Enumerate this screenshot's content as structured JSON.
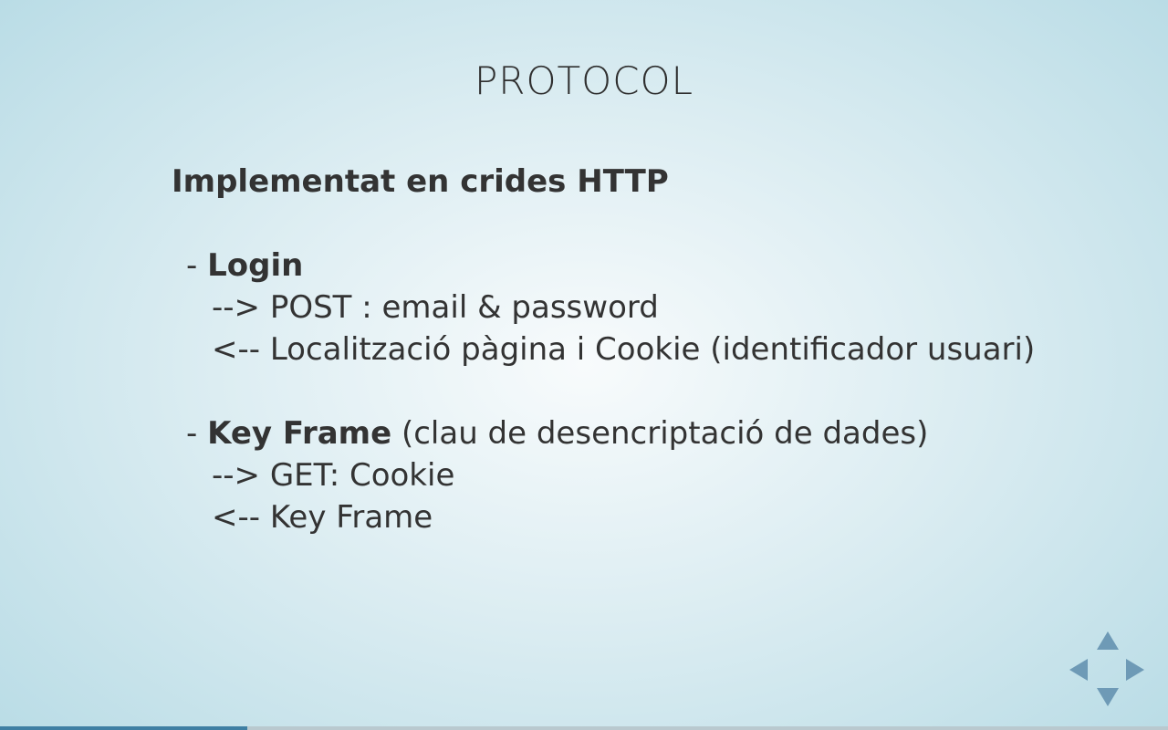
{
  "slide": {
    "title": "PROTOCOL",
    "heading": "Implementat en crides HTTP",
    "sections": [
      {
        "prefix": "- ",
        "label": "Login",
        "suffix": "",
        "lines": [
          "--> POST : email & password",
          "<-- Localització pàgina i Cookie (identificador usuari)"
        ]
      },
      {
        "prefix": "- ",
        "label": "Key Frame",
        "suffix": " (clau de desencriptació de dades)",
        "lines": [
          "--> GET: Cookie",
          "<-- Key Frame"
        ]
      }
    ]
  },
  "controls": {
    "icons": [
      "arrow-up-icon",
      "arrow-down-icon",
      "arrow-left-icon",
      "arrow-right-icon"
    ],
    "color": "#6e9ab6"
  },
  "progress": {
    "fraction": 0.212,
    "fill_color": "#3f7fa3",
    "track_color": "#b9c9cf"
  }
}
